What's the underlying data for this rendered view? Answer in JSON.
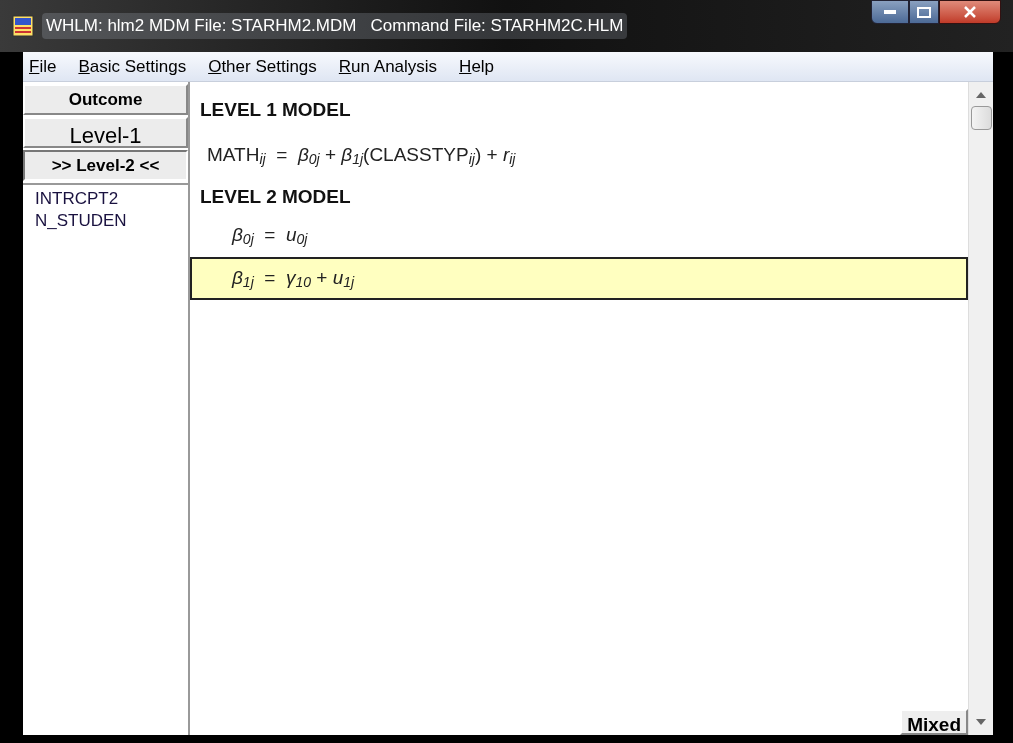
{
  "window": {
    "title": "WHLM: hlm2 MDM File: STARHM2.MDM   Command File: STARHM2C.HLM"
  },
  "menu": [
    "File",
    "Basic Settings",
    "Other Settings",
    "Run Analysis",
    "Help"
  ],
  "nav_buttons": [
    {
      "label": "Outcome",
      "selected": false
    },
    {
      "label": "Level-1",
      "selected": false
    },
    {
      "label": ">> Level-2 <<",
      "selected": true
    }
  ],
  "variables": [
    "INTRCPT2",
    "N_STUDEN"
  ],
  "level1": {
    "heading": "LEVEL 1 MODEL",
    "equation": "MATH$_{ij}$  =  *β*$_{0j}$ + *β*$_{1j}$(CLASSTYP$_{ij}$) + *r*$_{ij}$"
  },
  "level2": {
    "heading": "LEVEL 2 MODEL",
    "equations": [
      {
        "text": "*β*$_{0j}$  =  *u*$_{0j}$",
        "selected": false
      },
      {
        "text": "*β*$_{1j}$  =  *γ*$_{10}$ + *u*$_{1j}$",
        "selected": true
      }
    ]
  },
  "mixed_button": "Mixed"
}
